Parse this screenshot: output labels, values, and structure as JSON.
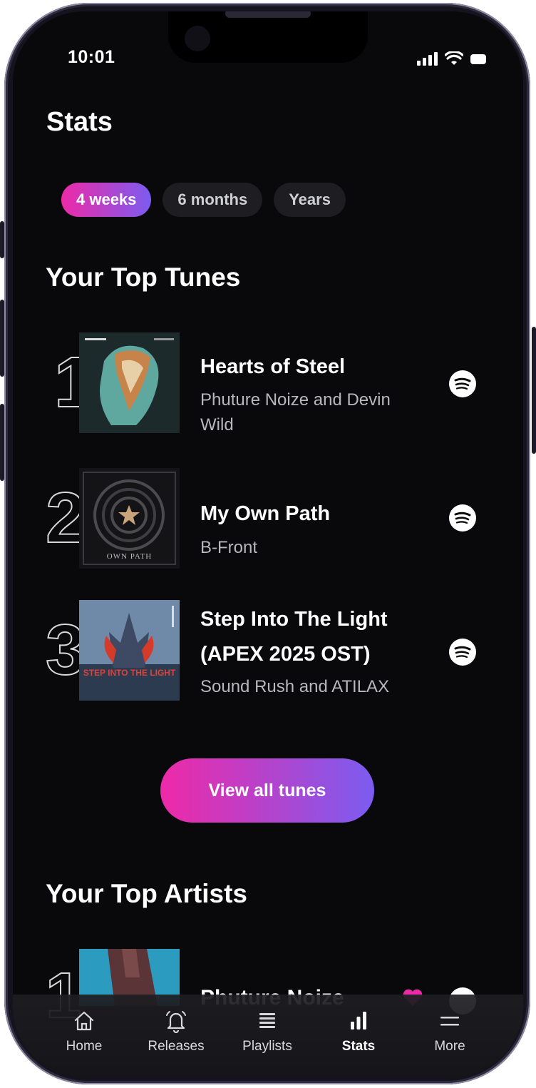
{
  "status_bar": {
    "time": "10:01"
  },
  "page": {
    "title": "Stats"
  },
  "filters": [
    {
      "label": "4 weeks",
      "active": true
    },
    {
      "label": "6 months",
      "active": false
    },
    {
      "label": "Years",
      "active": false
    }
  ],
  "top_tunes": {
    "heading": "Your Top Tunes",
    "items": [
      {
        "rank": "1",
        "title": "Hearts of Steel",
        "artist": "Phuture Noize and Devin Wild",
        "service_icon": "spotify-icon"
      },
      {
        "rank": "2",
        "title": "My Own Path",
        "artist": "B-Front",
        "service_icon": "spotify-icon",
        "cover_text": "OWN PATH"
      },
      {
        "rank": "3",
        "title": "Step Into The Light (APEX 2025 OST)",
        "artist": "Sound Rush and ATILAX",
        "service_icon": "spotify-icon",
        "cover_text": "STEP INTO THE LIGHT"
      }
    ],
    "view_all_label": "View all tunes"
  },
  "top_artists": {
    "heading": "Your Top Artists",
    "items": [
      {
        "rank": "1",
        "name": "Phuture Noize"
      }
    ]
  },
  "tab_bar": [
    {
      "label": "Home",
      "icon": "home-icon",
      "active": false
    },
    {
      "label": "Releases",
      "icon": "bell-icon",
      "active": false
    },
    {
      "label": "Playlists",
      "icon": "playlist-icon",
      "active": false
    },
    {
      "label": "Stats",
      "icon": "stats-icon",
      "active": true
    },
    {
      "label": "More",
      "icon": "menu-icon",
      "active": false
    }
  ],
  "colors": {
    "background": "#09090b",
    "accent_start": "#ee2aa8",
    "accent_end": "#7b5cf0",
    "chip_inactive": "#1e1e22"
  }
}
